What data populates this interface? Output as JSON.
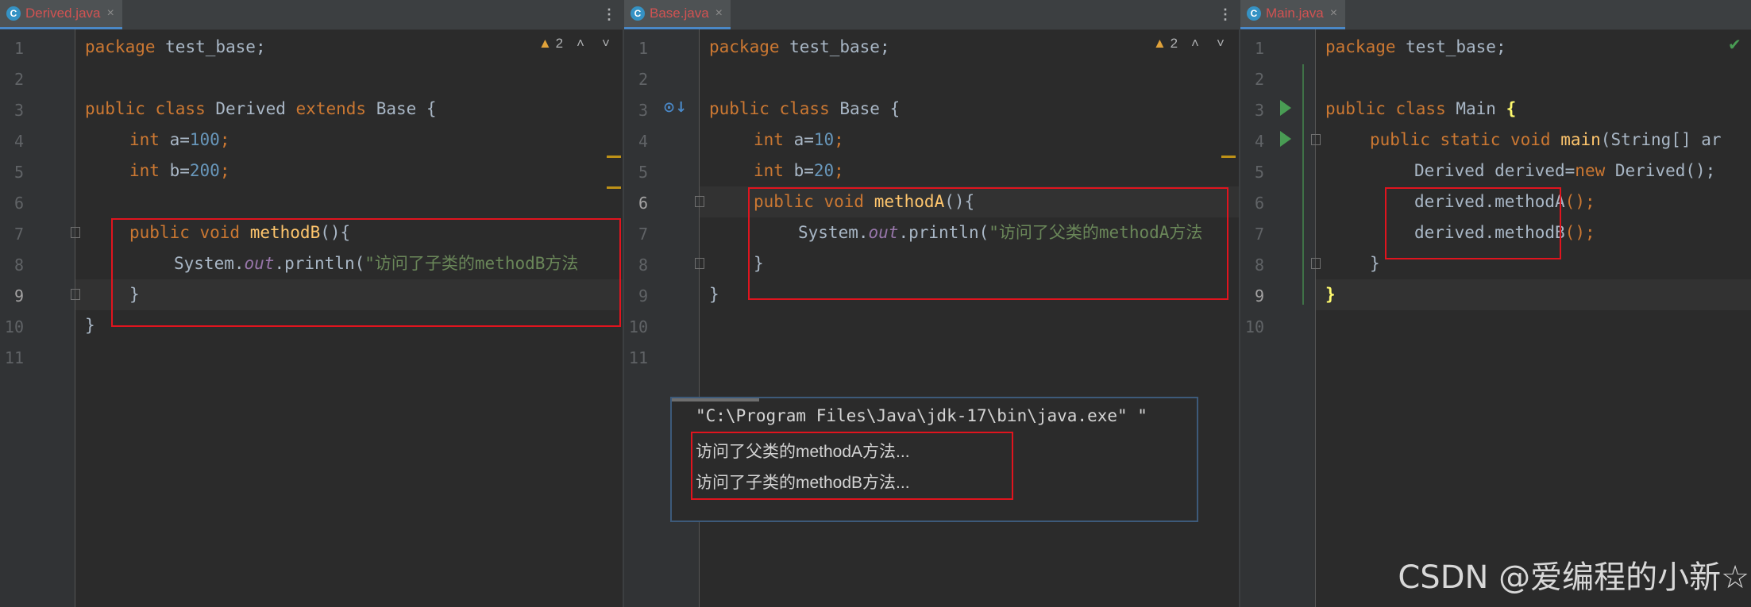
{
  "panes": [
    {
      "tab": {
        "icon": "C",
        "name": "Derived.java",
        "close": "×",
        "color": "#d25252"
      },
      "warnings": "2",
      "line_numbers": [
        "1",
        "2",
        "3",
        "4",
        "5",
        "6",
        "7",
        "8",
        "9",
        "10",
        "11"
      ],
      "lines": {
        "l1": [
          "package",
          " test_base;"
        ],
        "l3": [
          "public class ",
          "Derived ",
          "extends ",
          "Base {"
        ],
        "l4": [
          "int ",
          "a=",
          "100",
          ";"
        ],
        "l5": [
          "int ",
          "b=",
          "200",
          ";"
        ],
        "l7": [
          "public void ",
          "methodB",
          "(){"
        ],
        "l8": [
          "System.",
          "out",
          ".println(",
          "\"访问了子类的methodB方法"
        ],
        "l9": "}",
        "l10": "}"
      }
    },
    {
      "tab": {
        "icon": "C",
        "name": "Base.java",
        "close": "×",
        "color": "#d25252"
      },
      "warnings": "2",
      "line_numbers": [
        "1",
        "2",
        "3",
        "4",
        "5",
        "6",
        "7",
        "8",
        "9",
        "10",
        "11"
      ],
      "lines": {
        "l1": [
          "package",
          " test_base;"
        ],
        "l3": [
          "public class ",
          "Base {"
        ],
        "l4": [
          "int ",
          "a=",
          "10",
          ";"
        ],
        "l5": [
          "int ",
          "b=",
          "20",
          ";"
        ],
        "l6": [
          "public void ",
          "methodA",
          "(){"
        ],
        "l7": [
          "System.",
          "out",
          ".println(",
          "\"访问了父类的methodA方法"
        ],
        "l8": "}",
        "l9": "}"
      }
    },
    {
      "tab": {
        "icon": "C",
        "name": "Main.java",
        "close": "×",
        "color": "#d25252"
      },
      "line_numbers": [
        "1",
        "2",
        "3",
        "4",
        "5",
        "6",
        "7",
        "8",
        "9",
        "10"
      ],
      "lines": {
        "l1": [
          "package",
          " test_base;"
        ],
        "l3": [
          "public class ",
          "Main ",
          "{"
        ],
        "l4": [
          "public static void ",
          "main",
          "(String[] ar"
        ],
        "l5": [
          "Derived derived=",
          "new ",
          "Derived();"
        ],
        "l6": [
          "derived.",
          "methodA",
          "();"
        ],
        "l7": [
          "derived.",
          "methodB",
          "();"
        ],
        "l8": "}",
        "l9": "}"
      }
    }
  ],
  "console": {
    "cmd": "\"C:\\Program Files\\Java\\jdk-17\\bin\\java.exe\" \"",
    "out1": "访问了父类的methodA方法...",
    "out2": "访问了子类的methodB方法..."
  },
  "kebab_glyph": "⋮",
  "warning_glyph": "▲",
  "nav_up": "˄",
  "nav_down": "˅",
  "watermark": "CSDN @爱编程的小新☆",
  "colors": {
    "bg": "#2b2b2b",
    "keyword": "#cc7832",
    "method": "#ffc66d",
    "number": "#6897bb",
    "string": "#6a8759",
    "highlight": "#e0141e"
  }
}
